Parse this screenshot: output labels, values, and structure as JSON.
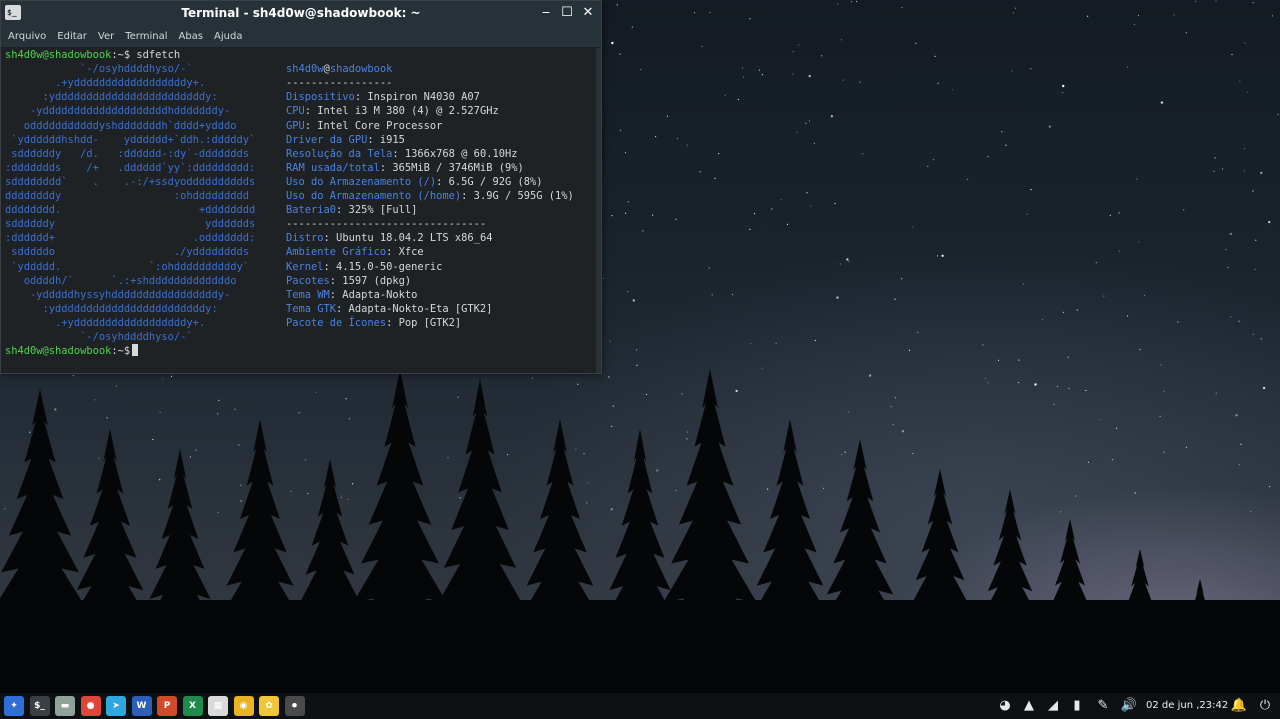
{
  "window": {
    "title": "Terminal - sh4d0w@shadowbook: ~",
    "icon_glyph": "$_",
    "minimize_glyph": "‒",
    "maximize_glyph": "☐",
    "close_glyph": "✕"
  },
  "menu": [
    "Arquivo",
    "Editar",
    "Ver",
    "Terminal",
    "Abas",
    "Ajuda"
  ],
  "terminal": {
    "prompt_user": "sh4d0w@shadowbook",
    "prompt_path": ":~$",
    "command": " sdfetch",
    "logo_lines": [
      "            `-/osyhddddhyso/-`",
      "        .+yddddddddddddddddddy+.",
      "      :yddddddddddddddddddddddddy:",
      "    -yddddddddddddddddddddhdddddddy-",
      "   odddddddddddyshdddddddh`dddd+ydddo",
      " `yddddddhshdd-    ydddddd+`ddh.:dddddy`",
      " sddddddy   /d.   :dddddd-:dy`-ddddddds",
      ":ddddddds    /+   .dddddd`yy`:ddddddddd:",
      "sdddddddd`    .    .-:/+ssdyodddddddddds",
      "ddddddddy                  :ohddddddddd",
      "dddddddd.                      +dddddddd",
      "sddddddy                        ydddddds",
      ":dddddd+                      .oddddddd:",
      " sdddddo                   ./ydddddddds",
      " `yddddd.              `:ohddddddddddy`",
      "   oddddh/`      `.:+shdddddddddddddo",
      "    -ydddddhyssyhdddddddddddddddddy-",
      "      :yddddddddddddddddddddddddy:",
      "        .+yddddddddddddddddddy+.",
      "            `-/osyhddddhyso/-`"
    ],
    "host_header": {
      "user": "sh4d0w",
      "at": "@",
      "host": "shadowbook"
    },
    "separator_short": "-----------------",
    "separator_long": "--------------------------------",
    "info_block_1": [
      {
        "key": "Dispositivo",
        "value": ": Inspiron N4030 A07"
      },
      {
        "key": "CPU",
        "value": ": Intel i3 M 380 (4) @ 2.527GHz"
      },
      {
        "key": "GPU",
        "value": ": Intel Core Processor"
      },
      {
        "key": "Driver da GPU",
        "value": ": i915"
      },
      {
        "key": "Resolução da Tela",
        "value": ": 1366x768 @ 60.10Hz"
      },
      {
        "key": "RAM usada/total",
        "value": ": 365MiB / 3746MiB (9%)"
      },
      {
        "key": "Uso do Armazenamento (/)",
        "value": ": 6.5G / 92G (8%)"
      },
      {
        "key": "Uso do Armazenamento (/home)",
        "value": ": 3.9G / 595G (1%)"
      },
      {
        "key": "Bateria0",
        "value": ": 325% [Full]"
      }
    ],
    "info_block_2": [
      {
        "key": "Distro",
        "value": ": Ubuntu 18.04.2 LTS x86_64"
      },
      {
        "key": "Ambiente Gráfico",
        "value": ": Xfce"
      },
      {
        "key": "Kernel",
        "value": ": 4.15.0-50-generic"
      },
      {
        "key": "Pacotes",
        "value": ": 1597 (dpkg)"
      },
      {
        "key": "Tema WM",
        "value": ": Adapta-Nokto"
      },
      {
        "key": "Tema GTK",
        "value": ": Adapta-Nokto-Eta [GTK2]"
      },
      {
        "key": "Pacote de Ícones",
        "value": ": Pop [GTK2]"
      }
    ]
  },
  "panel": {
    "launchers": [
      {
        "name": "whisker-menu",
        "glyph": "✦",
        "color": "#2d6fd6"
      },
      {
        "name": "terminal",
        "glyph": "$_",
        "color": "#3a3f44"
      },
      {
        "name": "file-manager",
        "glyph": "▬",
        "color": "#8fa39a"
      },
      {
        "name": "chrome",
        "glyph": "●",
        "color": "#e0453a"
      },
      {
        "name": "telegram",
        "glyph": "➤",
        "color": "#2ea6de"
      },
      {
        "name": "word",
        "glyph": "W",
        "color": "#2b5fb8"
      },
      {
        "name": "powerpoint",
        "glyph": "P",
        "color": "#d04a2b"
      },
      {
        "name": "excel",
        "glyph": "X",
        "color": "#1f8a4c"
      },
      {
        "name": "calculator",
        "glyph": "▦",
        "color": "#d9d9d9"
      },
      {
        "name": "media-player",
        "glyph": "◉",
        "color": "#e8b422"
      },
      {
        "name": "paint",
        "glyph": "✿",
        "color": "#f0c53a"
      },
      {
        "name": "recorder",
        "glyph": "⏺",
        "color": "#4a4a4a"
      }
    ],
    "tray": [
      "discord",
      "vlc",
      "wifi",
      "battery",
      "clip",
      "volume"
    ],
    "clock": "02 de jun ,23:42",
    "notifications_glyph": "🔔",
    "power_glyph": "⏻"
  }
}
